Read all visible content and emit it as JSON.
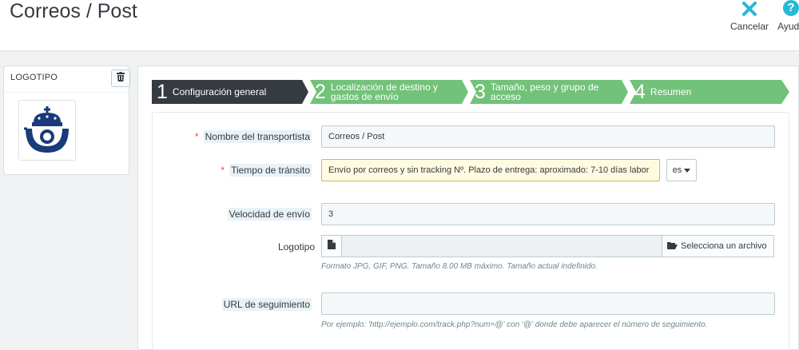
{
  "header": {
    "title": "Correos / Post",
    "cancel_label": "Cancelar",
    "help_label": "Ayuda",
    "help_glyph": "?"
  },
  "logo_panel": {
    "title": "LOGOTIPO"
  },
  "steps": [
    {
      "num": "1",
      "label": "Configuración general",
      "active": true
    },
    {
      "num": "2",
      "label": "Localización de destino y gastos de envío",
      "active": false
    },
    {
      "num": "3",
      "label": "Tamaño, peso y grupo de acceso",
      "active": false
    },
    {
      "num": "4",
      "label": "Resumen",
      "active": false
    }
  ],
  "form": {
    "carrier_name": {
      "label": "Nombre del transportista",
      "required": "*",
      "value": "Correos / Post"
    },
    "transit_time": {
      "label": "Tiempo de tránsito",
      "required": "*",
      "value": "Envío por correos y sin tracking Nº. Plazo de entrega: aproximado: 7-10 días labor",
      "lang": "es"
    },
    "speed": {
      "label": "Velocidad de envío",
      "value": "3"
    },
    "logo": {
      "label": "Logotipo",
      "value": "",
      "button": "Selecciona un archivo",
      "help": "Formato JPG, GIF, PNG. Tamaño 8.00 MB máximo. Tamaño actual indefinido."
    },
    "tracking_url": {
      "label": "URL de seguimiento",
      "value": "",
      "help": "Por ejemplo: 'http://ejemplo.com/track.php?num=@' con '@' donde debe aparecer el número de seguimiento."
    }
  },
  "colors": {
    "active_step": "#363a41",
    "inactive_step": "#72c279",
    "accent": "#25b9d7",
    "logo_blue": "#1a3b7a"
  },
  "icons": [
    "close-icon",
    "help-icon",
    "trash-icon",
    "correos-logo",
    "file-icon",
    "folder-open-icon",
    "caret-down-icon"
  ]
}
